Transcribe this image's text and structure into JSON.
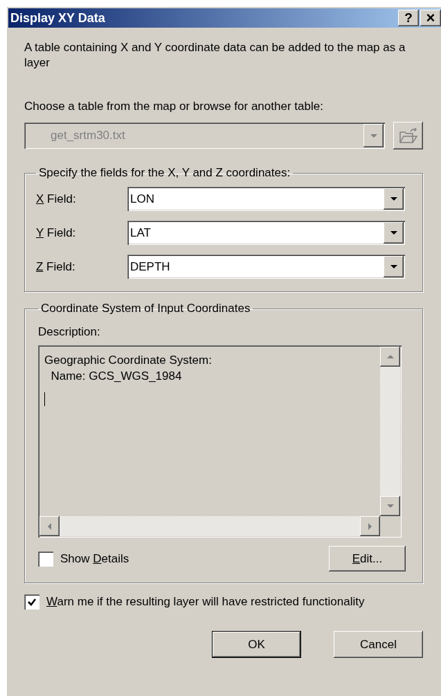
{
  "window": {
    "title": "Display XY Data",
    "title_buttons": [
      {
        "kind": "help",
        "label": "?"
      },
      {
        "kind": "close",
        "label": "×"
      }
    ]
  },
  "intro": "A table containing X and Y coordinate data can be added to the map as a layer",
  "table_prompt": "Choose a table from the map or browse for another table:",
  "table_combo": {
    "value": "get_srtm30.txt",
    "disabled": true
  },
  "xyz_group": {
    "title": "Specify the fields for the X, Y and Z coordinates:",
    "fields": [
      {
        "label": {
          "accel": "X",
          "after": " Field:"
        },
        "value": "LON"
      },
      {
        "label": {
          "accel": "Y",
          "after": " Field:"
        },
        "value": "LAT"
      },
      {
        "label": {
          "accel": "Z",
          "after": " Field:"
        },
        "value": "DEPTH"
      }
    ]
  },
  "coordinate_group": {
    "title": "Coordinate System of Input Coordinates",
    "description_label": "Description:",
    "description_lines": [
      "Geographic Coordinate System:",
      "  Name: GCS_WGS_1984"
    ],
    "show_details": {
      "label": {
        "before": "Show ",
        "accel": "D",
        "after": "etails"
      },
      "checked": false
    },
    "edit_button": {
      "label": {
        "accel": "E",
        "after": "dit..."
      }
    }
  },
  "warn": {
    "label": {
      "accel": "W",
      "after": "arn me if the resulting layer will have restricted functionality"
    },
    "checked": true
  },
  "buttons": [
    {
      "label": "OK",
      "default": true
    },
    {
      "label": "Cancel",
      "default": false
    }
  ]
}
